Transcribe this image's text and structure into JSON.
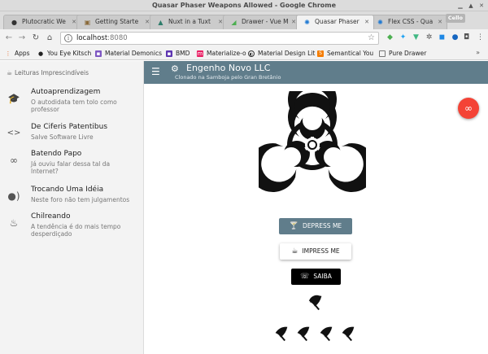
{
  "window": {
    "title": "Quasar Phaser Weapons Allowed - Google Chrome"
  },
  "tabs": [
    {
      "label": "Plutocratic We",
      "icon": "github-icon"
    },
    {
      "label": "Getting Starte",
      "icon": "owl-icon"
    },
    {
      "label": "Nuxt in a Tuxt",
      "icon": "nuxt-icon"
    },
    {
      "label": "Drawer - Vue M",
      "icon": "vuetify-icon"
    },
    {
      "label": "Quasar Phaser",
      "icon": "quasar-icon",
      "active": true
    },
    {
      "label": "Flex CSS - Qua",
      "icon": "quasar-icon"
    }
  ],
  "profile_label": "Cello",
  "address": {
    "host": "localhost",
    "port": ":8080"
  },
  "bookmarks": [
    {
      "label": "Apps",
      "icon": "apps-icon"
    },
    {
      "label": "You Eye Kitsch",
      "icon": "github-icon"
    },
    {
      "label": "Material Demonics",
      "icon": "bookmark-icon"
    },
    {
      "label": "BMD",
      "icon": "bookmark-icon"
    },
    {
      "label": "Materialize-o",
      "icon": "materialize-icon"
    },
    {
      "label": "Material Design Lit",
      "icon": "mdl-icon"
    },
    {
      "label": "Semantical You",
      "icon": "semantic-icon"
    },
    {
      "label": "Pure Drawer",
      "icon": "page-icon"
    }
  ],
  "drawer": {
    "header": "Leituras Imprescindíveis",
    "items": [
      {
        "label": "Autoaprendizagem",
        "sub": "O autodidata tem tolo como professor",
        "icon": "school-icon"
      },
      {
        "label": "De Ciferis Patentibus",
        "sub": "Salve Software Livre",
        "icon": "code-icon"
      },
      {
        "label": "Batendo Papo",
        "sub": "Já ouviu falar dessa tal da Internet?",
        "icon": "infinity-icon"
      },
      {
        "label": "Trocando Uma Idéia",
        "sub": "Neste foro não tem julgamentos",
        "icon": "record-voice-icon"
      },
      {
        "label": "Chilreando",
        "sub": "A tendência é do mais tempo desperdiçado",
        "icon": "smoking-icon"
      }
    ]
  },
  "appbar": {
    "title": "Engenho Novo LLC",
    "subtitle": "Clonado na Samboja pelo Gran Bretânio"
  },
  "buttons": {
    "depress": "Depress Me",
    "impress": "Impress Me",
    "saiba": "Saiba"
  },
  "colors": {
    "primary": "#607d8b",
    "fab": "#f44336",
    "dark_button": "#000000"
  }
}
